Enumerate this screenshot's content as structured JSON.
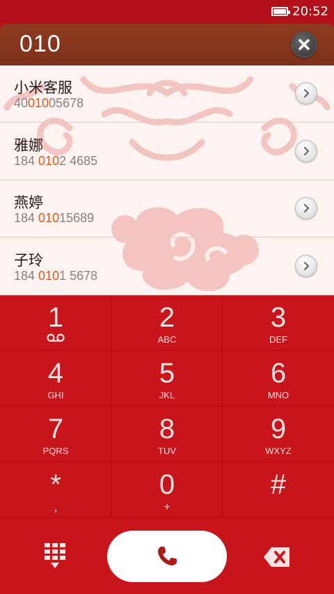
{
  "status_bar": {
    "time": "20:52",
    "battery_icon": "battery-icon"
  },
  "dialer": {
    "number": "010",
    "clear_icon": "clear-icon"
  },
  "contacts": [
    {
      "name": "小米客服",
      "number_pre": "40",
      "number_match": "010",
      "number_post": "05678"
    },
    {
      "name": "雅娜",
      "number_pre": "184 ",
      "number_match": "010",
      "number_post": "2 4685"
    },
    {
      "name": "燕婷",
      "number_pre": "184 ",
      "number_match": "010",
      "number_post": "15689"
    },
    {
      "name": "子玲",
      "number_pre": "184 ",
      "number_match": "010",
      "number_post": "1 5678"
    }
  ],
  "keypad": {
    "keys": [
      {
        "digit": "1",
        "letters": ""
      },
      {
        "digit": "2",
        "letters": "ABC"
      },
      {
        "digit": "3",
        "letters": "DEF"
      },
      {
        "digit": "4",
        "letters": "GHI"
      },
      {
        "digit": "5",
        "letters": "JKL"
      },
      {
        "digit": "6",
        "letters": "MNO"
      },
      {
        "digit": "7",
        "letters": "PQRS"
      },
      {
        "digit": "8",
        "letters": "TUV"
      },
      {
        "digit": "9",
        "letters": "WXYZ"
      },
      {
        "digit": "*",
        "letters": ","
      },
      {
        "digit": "0",
        "letters": "+"
      },
      {
        "digit": "#",
        "letters": ""
      }
    ]
  },
  "colors": {
    "accent": "#c8141b",
    "highlight": "#e8561a",
    "header": "#8e3b22"
  }
}
